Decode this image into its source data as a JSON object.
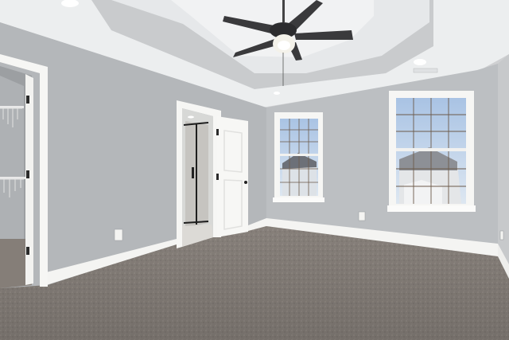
{
  "scene": {
    "subject": "empty-bedroom",
    "colors": {
      "wall": "#b4b7ba",
      "wall_right": "#bcbfc2",
      "ceiling": "#eceeef",
      "tray": "#c9cbcd",
      "carpet": "#8e8781",
      "trim": "#f4f4f2",
      "fan_blade": "#3a3a3c",
      "sky": "#b8cde6"
    }
  }
}
